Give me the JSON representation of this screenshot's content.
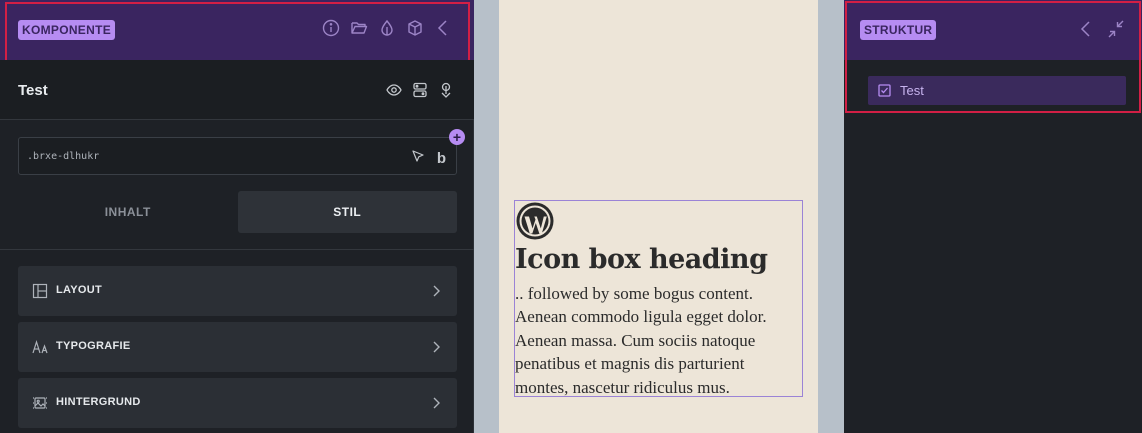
{
  "left_panel": {
    "header": {
      "badge": "KOMPONENTE",
      "icons": [
        "info-icon",
        "folder-open-icon",
        "droplet-icon",
        "cube-icon",
        "chevron-left-icon"
      ]
    },
    "element": {
      "title": "Test",
      "icons": [
        "eye-icon",
        "toggle-layout-icon",
        "touch-pointer-icon"
      ]
    },
    "selector": {
      "value": ".brxe-dlhukr",
      "add_symbol": "+",
      "icons": [
        "cursor-icon",
        "b-icon"
      ],
      "b_glyph": "b"
    },
    "tabs": [
      {
        "label": "INHALT",
        "active": false
      },
      {
        "label": "STIL",
        "active": true
      }
    ],
    "groups": [
      {
        "label": "LAYOUT",
        "icon": "layout-icon"
      },
      {
        "label": "TYPOGRAFIE",
        "icon": "typography-icon"
      },
      {
        "label": "HINTERGRUND",
        "icon": "background-icon"
      }
    ]
  },
  "canvas": {
    "icon_box": {
      "icon": "wordpress-icon",
      "heading": "Icon box heading",
      "text": ".. followed by some bogus content. Aenean commodo ligula egget dolor. Aenean massa. Cum sociis natoque penatibus et magnis dis parturient montes, nascetur ridiculus mus."
    }
  },
  "right_panel": {
    "header": {
      "badge": "STRUKTUR",
      "icons": [
        "chevron-left-icon",
        "collapse-icon"
      ]
    },
    "items": [
      {
        "label": "Test",
        "icon": "checkbox-icon"
      }
    ]
  },
  "colors": {
    "accent": "#b68cf2",
    "header_bg": "#3a2560",
    "panel_bg": "#1e2126",
    "highlight_outline": "#d21f45",
    "page_bg": "#ede5d8"
  }
}
